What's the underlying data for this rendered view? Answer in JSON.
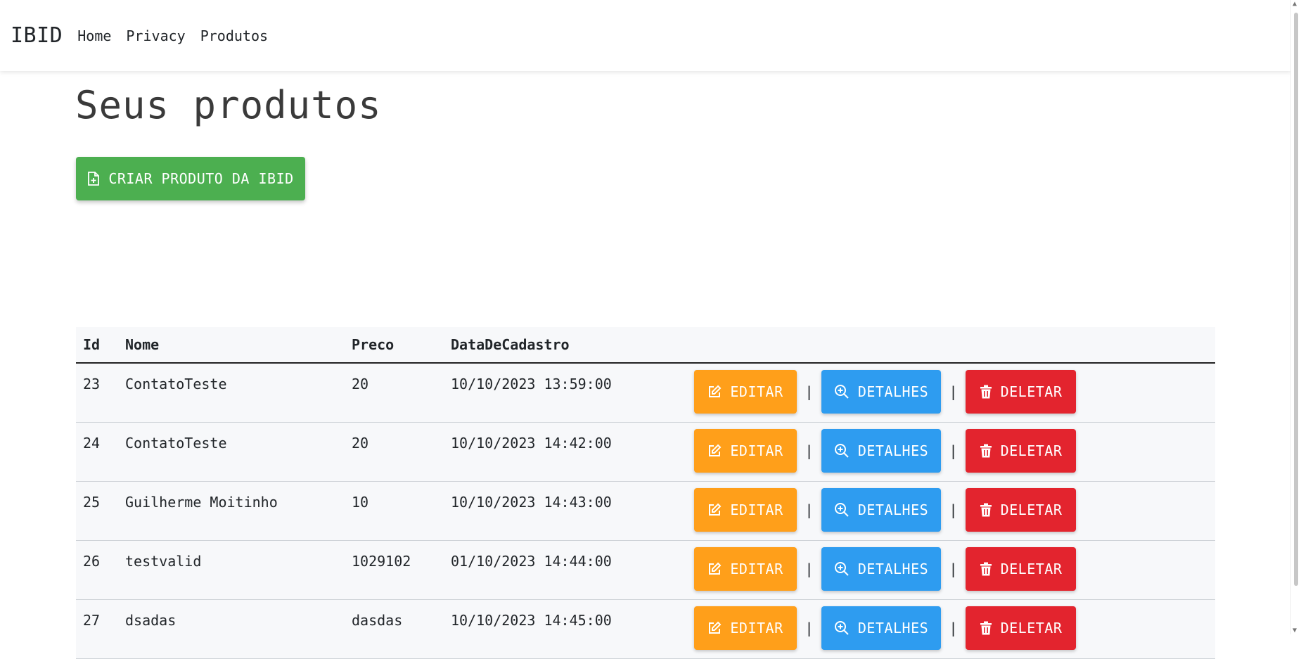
{
  "navbar": {
    "brand": "IBID",
    "links": [
      "Home",
      "Privacy",
      "Produtos"
    ]
  },
  "page": {
    "title": "Seus produtos",
    "create_button": "CRIAR PRODUTO DA IBID"
  },
  "table": {
    "headers": [
      "Id",
      "Nome",
      "Preco",
      "DataDeCadastro"
    ],
    "rows": [
      {
        "id": "23",
        "nome": "ContatoTeste",
        "preco": "20",
        "data": "10/10/2023 13:59:00"
      },
      {
        "id": "24",
        "nome": "ContatoTeste",
        "preco": "20",
        "data": "10/10/2023 14:42:00"
      },
      {
        "id": "25",
        "nome": "Guilherme Moitinho",
        "preco": "10",
        "data": "10/10/2023 14:43:00"
      },
      {
        "id": "26",
        "nome": "testvalid",
        "preco": "1029102",
        "data": "01/10/2023 14:44:00"
      },
      {
        "id": "27",
        "nome": "dsadas",
        "preco": "dasdas",
        "data": "10/10/2023 14:45:00"
      }
    ]
  },
  "actions": {
    "edit": "EDITAR",
    "details": "DETALHES",
    "delete": "DELETAR",
    "separator": "|"
  },
  "colors": {
    "create": "#4caf50",
    "edit": "#ff9f1a",
    "details": "#2e9cf0",
    "delete": "#e3242e"
  },
  "icons": {
    "create": "file-plus-icon",
    "edit": "edit-icon",
    "details": "zoom-in-icon",
    "delete": "trash-icon"
  }
}
